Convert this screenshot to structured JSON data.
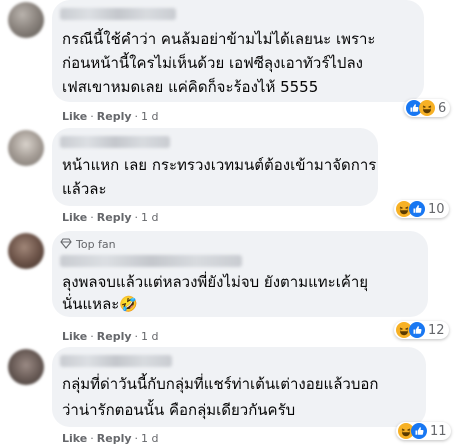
{
  "comments": [
    {
      "text_lines": [
        "กรณีนี้ใช้คำว่า คนล้มอย่าข้ามไม่ได้เลยนะ เพราะ",
        "ก่อนหน้านี้ใครไม่เห็นด้วย เอฟซีลุงเอาทัวร์ไปลง",
        "เฟสเขาหมดเลย แค่คิดก็จะร้องไห้ 5555"
      ],
      "like_label": "Like",
      "reply_label": "Reply",
      "time": "1 d",
      "reaction_count": "6",
      "reaction_icons": [
        "like-icon",
        "haha-icon"
      ]
    },
    {
      "text_lines": [
        "หน้าแหก เลย กระทรวงเวทมนต์ต้องเข้ามาจัดการ",
        "แล้วละ"
      ],
      "like_label": "Like",
      "reply_label": "Reply",
      "time": "1 d",
      "reaction_count": "10",
      "reaction_icons": [
        "haha-icon",
        "like-icon"
      ]
    },
    {
      "badge": "Top fan",
      "text_lines": [
        "ลุงพลจบแล้วแต่หลวงพี่ยังไม่จบ ยังตามแทะเค้ายุ",
        "นั่นแหละ🤣"
      ],
      "like_label": "Like",
      "reply_label": "Reply",
      "time": "1 d",
      "reaction_count": "12",
      "reaction_icons": [
        "haha-icon",
        "like-icon"
      ]
    },
    {
      "text_lines": [
        "กลุ่มที่ด่าวันนี้กับกลุ่มที่แชร์ท่าเต้นเต่างอยแล้วบอก",
        "ว่าน่ารักตอนนั้น คือกลุ่มเดียวกันครับ"
      ],
      "like_label": "Like",
      "reply_label": "Reply",
      "time": "1 d",
      "reaction_count": "11",
      "reaction_icons": [
        "haha-icon",
        "like-icon"
      ]
    }
  ],
  "separator": "·",
  "colors": {
    "bubble": "#f0f2f5",
    "like_blue": "#1877f2",
    "haha_yellow": "#f7b125",
    "meta_gray": "#65676b"
  }
}
